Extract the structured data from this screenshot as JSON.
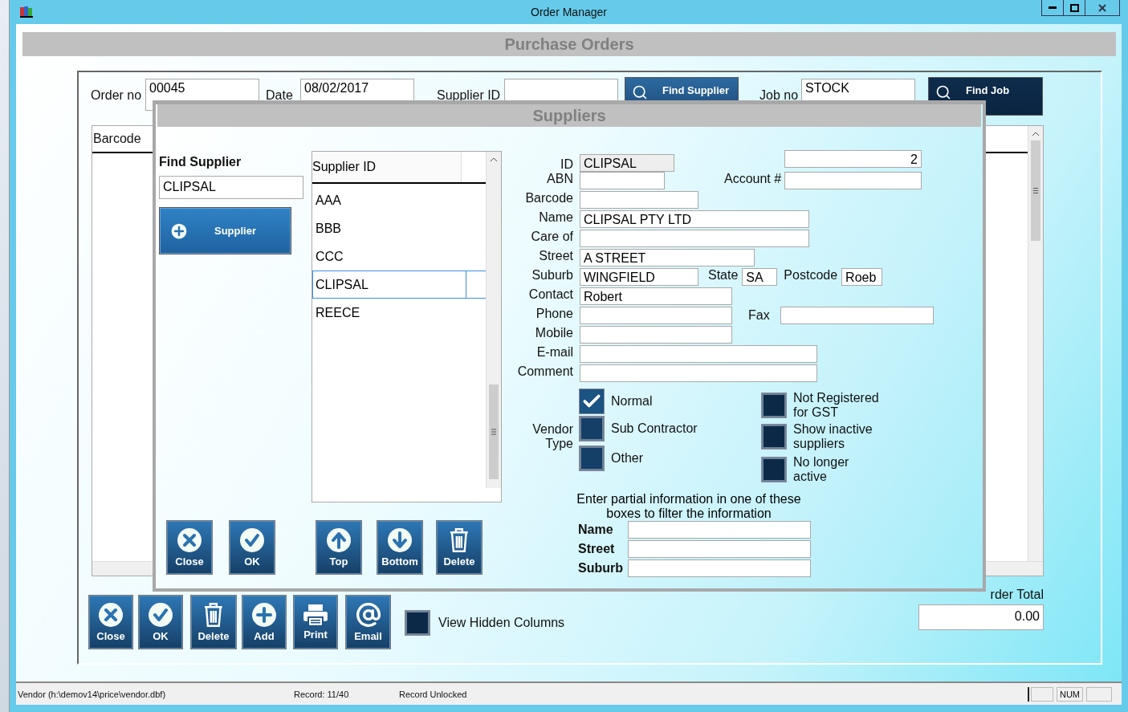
{
  "window": {
    "title": "Order Manager"
  },
  "header": {
    "title": "Purchase Orders"
  },
  "order": {
    "order_no": {
      "label": "Order no",
      "value": "00045"
    },
    "date": {
      "label": "Date",
      "value": "08/02/2017"
    },
    "supplier_id": {
      "label": "Supplier ID"
    },
    "find_supplier": "Find Supplier",
    "job_no": {
      "label": "Job no",
      "value": "STOCK"
    },
    "find_job": "Find Job"
  },
  "grid": {
    "columns": [
      "Barcode"
    ]
  },
  "buttons": [
    {
      "label": "Close",
      "kind": "close"
    },
    {
      "label": "OK",
      "kind": "ok"
    },
    {
      "label": "Delete",
      "kind": "delete"
    },
    {
      "label": "Add",
      "kind": "add"
    },
    {
      "label": "Print",
      "kind": "print"
    },
    {
      "label": "Email",
      "kind": "email"
    }
  ],
  "view_hidden_columns": {
    "label": "View Hidden Columns",
    "checked": false
  },
  "order_total": {
    "label": "rder Total",
    "value": "0.00"
  },
  "status_bar": {
    "file": "Vendor (h:\\demov14\\price\\vendor.dbf)",
    "record": "Record: 11/40",
    "lock": "Record Unlocked",
    "num": "NUM"
  },
  "dialog": {
    "title": "Suppliers",
    "find": {
      "label": "Find Supplier",
      "value": "CLIPSAL"
    },
    "add_button": {
      "label": "Supplier",
      "kind": "add"
    },
    "list": {
      "column": "Supplier ID",
      "rows": [
        {
          "text": "AAA",
          "selected": false
        },
        {
          "text": "BBB",
          "selected": false
        },
        {
          "text": "CCC",
          "selected": false
        },
        {
          "text": "CLIPSAL",
          "selected": true
        },
        {
          "text": "REECE",
          "selected": false
        }
      ]
    },
    "buttons": [
      {
        "label": "Close",
        "kind": "close"
      },
      {
        "label": "OK",
        "kind": "ok"
      },
      {
        "label": "Top",
        "kind": "top"
      },
      {
        "label": "Bottom",
        "kind": "bottom"
      },
      {
        "label": "Delete",
        "kind": "delete"
      }
    ],
    "details": {
      "id": {
        "label": "ID",
        "value": "CLIPSAL"
      },
      "number": {
        "value": "2"
      },
      "abn": {
        "label": "ABN"
      },
      "account": {
        "label": "Account #"
      },
      "barcode": {
        "label": "Barcode"
      },
      "name": {
        "label": "Name",
        "value": "CLIPSAL PTY LTD"
      },
      "care_of": {
        "label": "Care of"
      },
      "street": {
        "label": "Street",
        "value": "A STREET"
      },
      "suburb": {
        "label": "Suburb",
        "value": "WINGFIELD"
      },
      "state": {
        "label": "State",
        "value": "SA"
      },
      "postcode": {
        "label": "Postcode",
        "value": "Roeb"
      },
      "contact": {
        "label": "Contact",
        "value": "Robert"
      },
      "phone": {
        "label": "Phone"
      },
      "fax": {
        "label": "Fax"
      },
      "mobile": {
        "label": "Mobile"
      },
      "email": {
        "label": "E-mail"
      },
      "comment": {
        "label": "Comment"
      }
    },
    "vendor_type": {
      "label": "Vendor Type",
      "options": [
        {
          "label": "Normal",
          "checked": true
        },
        {
          "label": "Sub Contractor",
          "checked": false
        },
        {
          "label": "Other",
          "checked": false
        }
      ]
    },
    "flags": [
      {
        "label": "Not Registered for GST",
        "checked": false
      },
      {
        "label": "Show inactive suppliers",
        "checked": false
      },
      {
        "label": "No longer active",
        "checked": false
      }
    ],
    "filter": {
      "hint": "Enter partial information in one of these boxes to filter the information",
      "fields": [
        {
          "label": "Name"
        },
        {
          "label": "Street"
        },
        {
          "label": "Suburb"
        }
      ]
    }
  }
}
